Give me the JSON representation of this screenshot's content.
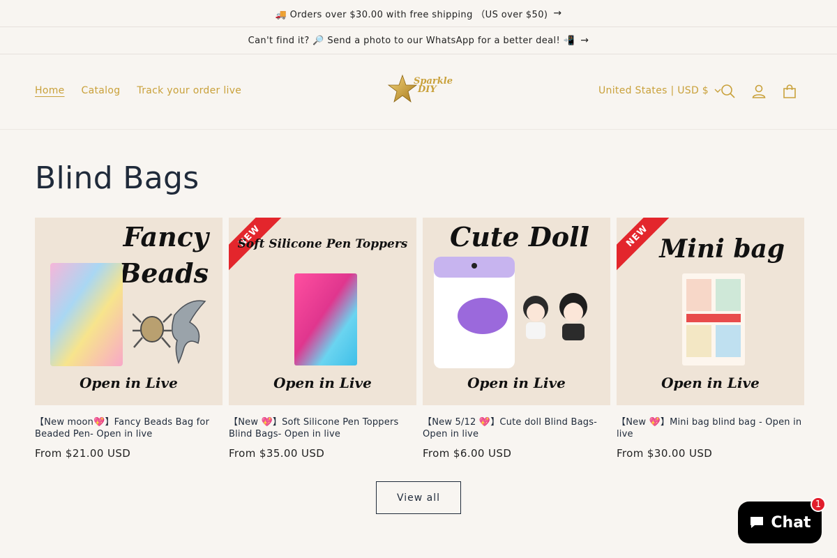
{
  "announcements": [
    {
      "text": "🚚 Orders over $30.00 with free shipping （US over $50)"
    },
    {
      "text": "Can't find it? 🔎 Send a photo to our WhatsApp for a better deal! 📲"
    }
  ],
  "nav": [
    {
      "label": "Home"
    },
    {
      "label": "Catalog"
    },
    {
      "label": "Track your order live"
    }
  ],
  "logo": {
    "line1": "Sparkle",
    "line2": "DIY"
  },
  "country_selector": {
    "label": "United States | USD $"
  },
  "icons": {
    "search": "search-icon",
    "account": "account-icon",
    "cart": "cart-icon"
  },
  "colors": {
    "accent": "#c9a13b",
    "background": "#f8f5f1",
    "heading": "#1f2a3a",
    "new_ribbon": "#e3262c"
  },
  "collection": {
    "title": "Blind Bags"
  },
  "products": [
    {
      "image_headline": "Fancy Beads",
      "image_footer": "Open in Live",
      "new_ribbon": "",
      "title": "【New moon💖】Fancy Beads Bag for Beaded Pen- Open in live",
      "price": "From $21.00 USD"
    },
    {
      "image_headline": "Soft Silicone Pen Toppers",
      "image_footer": "Open in Live",
      "new_ribbon": "NEW",
      "title": "【New 💖】Soft Silicone Pen Toppers Blind Bags- Open in live",
      "price": "From $35.00 USD"
    },
    {
      "image_headline": "Cute Doll",
      "image_footer": "Open in Live",
      "new_ribbon": "",
      "title": "【New 5/12 💖】Cute doll Blind Bags- Open in live",
      "price": "From $6.00 USD"
    },
    {
      "image_headline": "Mini bag",
      "image_footer": "Open in Live",
      "new_ribbon": "NEW",
      "title": "【New 💖】Mini bag blind bag - Open in live",
      "price": "From $30.00 USD"
    }
  ],
  "view_all": {
    "label": "View all"
  },
  "chat": {
    "label": "Chat",
    "badge_count": "1"
  }
}
